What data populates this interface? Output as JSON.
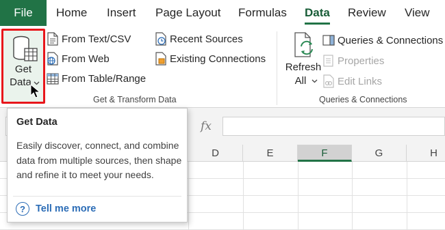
{
  "tabs": {
    "file": "File",
    "home": "Home",
    "insert": "Insert",
    "page_layout": "Page Layout",
    "formulas": "Formulas",
    "data": "Data",
    "review": "Review",
    "view": "View"
  },
  "get_transform": {
    "get_data_line1": "Get",
    "get_data_line2": "Data",
    "from_text_csv": "From Text/CSV",
    "from_web": "From Web",
    "from_table_range": "From Table/Range",
    "recent_sources": "Recent Sources",
    "existing_connections": "Existing Connections",
    "group_label": "Get & Transform Data"
  },
  "queries": {
    "refresh_line1": "Refresh",
    "refresh_line2": "All",
    "queries_connections": "Queries & Connections",
    "properties": "Properties",
    "edit_links": "Edit Links",
    "group_label": "Queries & Connections"
  },
  "formula_bar": {
    "fx": "fx"
  },
  "columns": [
    "D",
    "E",
    "F",
    "G",
    "H"
  ],
  "selected_column": "F",
  "tooltip": {
    "title": "Get Data",
    "body": "Easily discover, connect, and combine data from multiple sources, then shape and refine it to meet your needs.",
    "tell_me_more": "Tell me more"
  },
  "colors": {
    "accent": "#217346",
    "highlight_box": "#e8161b",
    "link": "#2b6cb6"
  }
}
